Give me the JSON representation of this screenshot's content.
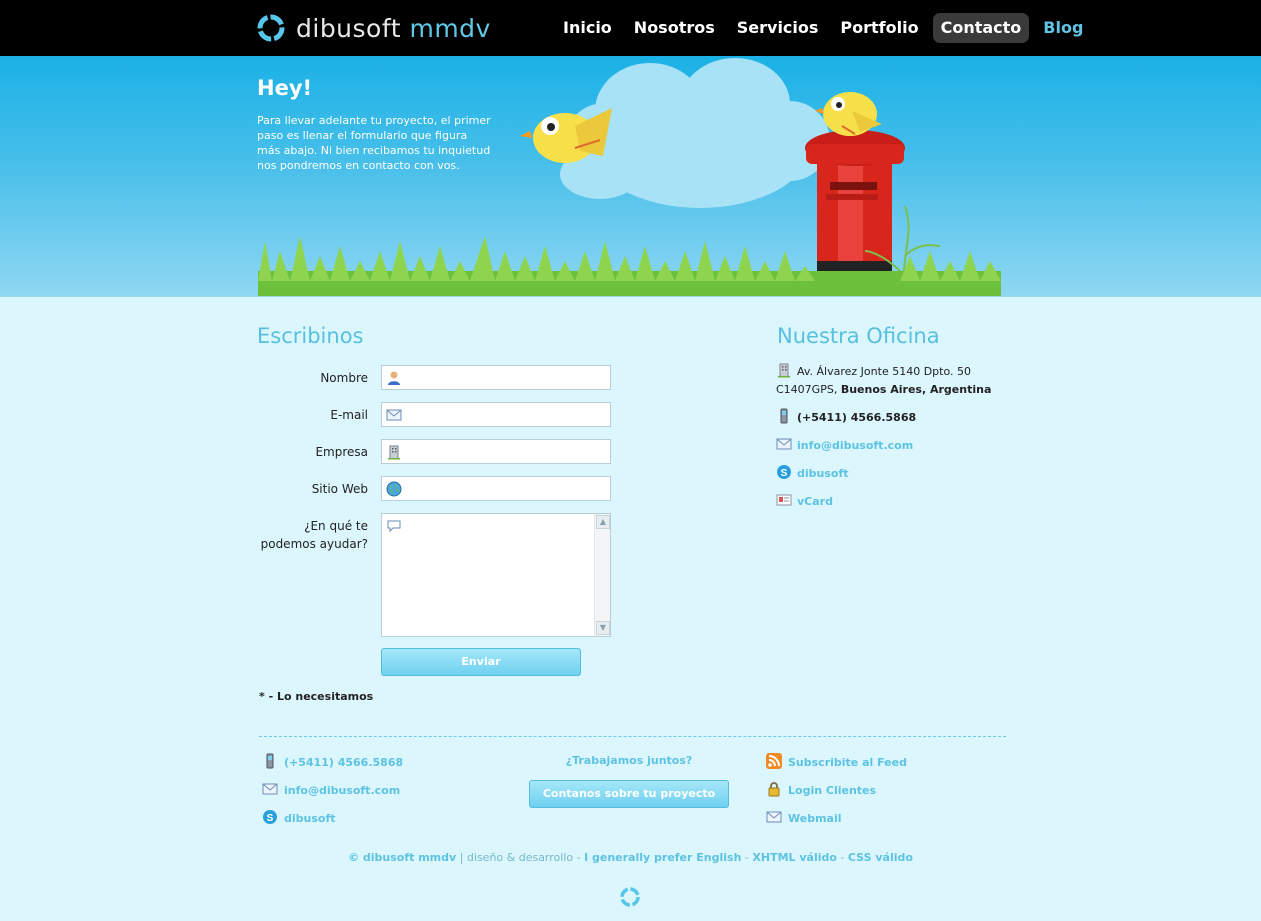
{
  "header": {
    "logo_part1": "dibusoft",
    "logo_part2": "mmdv",
    "nav": [
      {
        "label": "Inicio"
      },
      {
        "label": "Nosotros"
      },
      {
        "label": "Servicios"
      },
      {
        "label": "Portfolio"
      },
      {
        "label": "Contacto"
      },
      {
        "label": "Blog"
      }
    ],
    "active_nav": "Contacto"
  },
  "hero": {
    "title": "Hey!",
    "text": "Para llevar adelante tu proyecto, el primer paso es llenar el formulario que figura más abajo. Ni bien recibamos tu inquietud nos pondremos en contacto con vos."
  },
  "form": {
    "title": "Escribinos",
    "fields": [
      {
        "label": "Nombre",
        "icon": "user-icon",
        "value": ""
      },
      {
        "label": "E-mail",
        "icon": "envelope-icon",
        "value": ""
      },
      {
        "label": "Empresa",
        "icon": "building-icon",
        "value": ""
      },
      {
        "label": "Sitio Web",
        "icon": "globe-icon",
        "value": ""
      }
    ],
    "message_label_line1": "¿En qué te",
    "message_label_line2": "podemos ayudar?",
    "message_icon": "speech-bubble-icon",
    "submit_label": "Enviar",
    "required_note": "* - Lo necesitamos"
  },
  "office": {
    "title": "Nuestra Oficina",
    "address_line1": "Av. Álvarez Jonte 5140 Dpto. 50",
    "address_line2_plain": "C1407GPS,",
    "address_line2_bold": "Buenos Aires, Argentina",
    "phone": "(+5411) 4566.5868",
    "email": "info@dibusoft.com",
    "skype": "dibusoft",
    "vcard": "vCard"
  },
  "footer": {
    "phone": "(+5411) 4566.5868",
    "email": "info@dibusoft.com",
    "skype": "dibusoft",
    "center_title": "¿Trabajamos juntos?",
    "center_button": "Contanos sobre tu proyecto",
    "feed": "Subscribite al Feed",
    "login": "Login Clientes",
    "webmail": "Webmail",
    "copyright_brand": "© dibusoft mmdv",
    "sep1": " | diseño & desarrollo - ",
    "english": "I generally prefer English",
    "sep2": " - ",
    "xhtml": "XHTML válido",
    "sep3": " - ",
    "css": "CSS válido"
  },
  "colors": {
    "accent": "#5cc3e3",
    "page_bg": "#dcf6fd",
    "header_bg": "#000000",
    "sky_top": "#1bb1e6",
    "mailbox_red": "#d9261c"
  }
}
